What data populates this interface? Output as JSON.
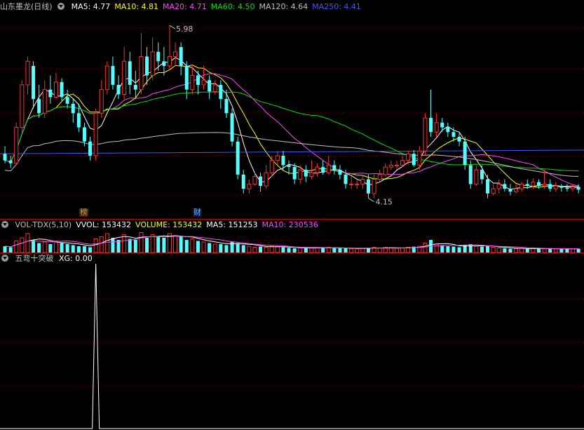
{
  "title": "山东墨龙(日线)",
  "ma_labels": [
    {
      "text": "MA5: 4.77",
      "color": "#ffffff"
    },
    {
      "text": "MA10: 4.81",
      "color": "#ffff00"
    },
    {
      "text": "MA20: 4.71",
      "color": "#ff44ff"
    },
    {
      "text": "MA60: 4.50",
      "color": "#00e000"
    },
    {
      "text": "MA120: 4.64",
      "color": "#c0c0c0"
    },
    {
      "text": "MA250: 4.41",
      "color": "#4455ff"
    }
  ],
  "vol_labels": [
    {
      "text": "VOL-TDX(5,10)",
      "color": "#c0c0c0"
    },
    {
      "text": "VVOL: 153432",
      "color": "#ffffff"
    },
    {
      "text": "VOLUME: 153432",
      "color": "#ffff00"
    },
    {
      "text": "MA5: 151253",
      "color": "#ffffff"
    },
    {
      "text": "MA10: 230536",
      "color": "#ff44ff"
    }
  ],
  "ind_title": "五弯十突破",
  "ind_value": "XG: 0.00",
  "high_label": "5.98",
  "low_label": "4.15",
  "badges": [
    "榜",
    "财"
  ],
  "colors": {
    "up": "#ff3030",
    "down": "#54ffff",
    "grid": "#8b0000",
    "frame": "#c00000"
  },
  "chart_data": {
    "type": "candlestick",
    "price": {
      "candles": [
        [
          4.62,
          4.55,
          4.7,
          4.52
        ],
        [
          4.55,
          4.52,
          4.6,
          4.47
        ],
        [
          4.52,
          4.9,
          4.95,
          4.5
        ],
        [
          4.9,
          5.35,
          5.4,
          4.85
        ],
        [
          5.35,
          5.6,
          5.65,
          5.25
        ],
        [
          5.55,
          5.2,
          5.6,
          5.1
        ],
        [
          5.2,
          5.05,
          5.35,
          5.0
        ],
        [
          5.05,
          5.3,
          5.4,
          5.0
        ],
        [
          5.3,
          5.22,
          5.45,
          5.15
        ],
        [
          5.22,
          5.38,
          5.48,
          5.2
        ],
        [
          5.38,
          5.22,
          5.42,
          5.18
        ],
        [
          5.22,
          5.15,
          5.3,
          5.1
        ],
        [
          5.15,
          5.05,
          5.2,
          4.95
        ],
        [
          5.05,
          4.9,
          5.15,
          4.85
        ],
        [
          4.9,
          4.75,
          4.95,
          4.7
        ],
        [
          4.75,
          4.6,
          4.8,
          4.55
        ],
        [
          4.6,
          5.05,
          5.1,
          4.55
        ],
        [
          5.05,
          5.3,
          5.4,
          5.0
        ],
        [
          5.3,
          5.55,
          5.6,
          5.25
        ],
        [
          5.55,
          5.35,
          5.65,
          5.3
        ],
        [
          5.35,
          5.25,
          5.45,
          5.2
        ],
        [
          5.25,
          5.6,
          5.75,
          5.2
        ],
        [
          5.6,
          5.35,
          5.7,
          5.25
        ],
        [
          5.35,
          5.3,
          5.5,
          5.2
        ],
        [
          5.3,
          5.65,
          5.9,
          5.25
        ],
        [
          5.65,
          5.45,
          5.75,
          5.35
        ],
        [
          5.45,
          5.7,
          5.85,
          5.4
        ],
        [
          5.7,
          5.6,
          5.8,
          5.5
        ],
        [
          5.6,
          5.55,
          5.75,
          5.45
        ],
        [
          5.55,
          5.65,
          5.98,
          5.5
        ],
        [
          5.65,
          5.7,
          5.8,
          5.55
        ],
        [
          5.75,
          5.55,
          5.8,
          5.45
        ],
        [
          5.55,
          5.3,
          5.6,
          5.2
        ],
        [
          5.3,
          5.45,
          5.55,
          5.25
        ],
        [
          5.45,
          5.35,
          5.5,
          5.25
        ],
        [
          5.35,
          5.4,
          5.55,
          5.3
        ],
        [
          5.4,
          5.28,
          5.45,
          5.2
        ],
        [
          5.28,
          5.35,
          5.4,
          5.25
        ],
        [
          5.35,
          5.2,
          5.4,
          5.1
        ],
        [
          5.2,
          5.05,
          5.3,
          5.0
        ],
        [
          5.05,
          4.75,
          5.1,
          4.7
        ],
        [
          4.75,
          4.4,
          4.8,
          4.35
        ],
        [
          4.4,
          4.25,
          4.45,
          4.2
        ],
        [
          4.25,
          4.3,
          4.35,
          4.2
        ],
        [
          4.3,
          4.38,
          4.42,
          4.28
        ],
        [
          4.38,
          4.28,
          4.42,
          4.22
        ],
        [
          4.28,
          4.42,
          4.5,
          4.25
        ],
        [
          4.42,
          4.55,
          4.6,
          4.38
        ],
        [
          4.55,
          4.6,
          4.65,
          4.5
        ],
        [
          4.6,
          4.5,
          4.65,
          4.45
        ],
        [
          4.5,
          4.48,
          4.55,
          4.4
        ],
        [
          4.48,
          4.35,
          4.52,
          4.3
        ],
        [
          4.35,
          4.45,
          4.5,
          4.3
        ],
        [
          4.45,
          4.38,
          4.5,
          4.32
        ],
        [
          4.38,
          4.42,
          4.55,
          4.35
        ],
        [
          4.42,
          4.48,
          4.52,
          4.38
        ],
        [
          4.48,
          4.42,
          4.55,
          4.4
        ],
        [
          4.42,
          4.5,
          4.6,
          4.4
        ],
        [
          4.5,
          4.45,
          4.55,
          4.4
        ],
        [
          4.45,
          4.4,
          4.5,
          4.35
        ],
        [
          4.4,
          4.3,
          4.45,
          4.25
        ],
        [
          4.3,
          4.3,
          4.38,
          4.25
        ],
        [
          4.3,
          4.3,
          4.35,
          4.25
        ],
        [
          4.3,
          4.35,
          4.4,
          4.25
        ],
        [
          4.35,
          4.2,
          4.4,
          4.15
        ],
        [
          4.2,
          4.35,
          4.4,
          4.15
        ],
        [
          4.35,
          4.4,
          4.45,
          4.32
        ],
        [
          4.4,
          4.48,
          4.52,
          4.38
        ],
        [
          4.48,
          4.5,
          4.55,
          4.45
        ],
        [
          4.5,
          4.5,
          4.55,
          4.45
        ],
        [
          4.5,
          4.55,
          4.6,
          4.48
        ],
        [
          4.55,
          4.62,
          4.65,
          4.5
        ],
        [
          4.62,
          4.5,
          4.66,
          4.48
        ],
        [
          4.5,
          4.65,
          4.7,
          4.45
        ],
        [
          4.65,
          5.0,
          5.05,
          4.6
        ],
        [
          5.0,
          4.85,
          5.3,
          4.8
        ],
        [
          4.85,
          4.95,
          5.05,
          4.8
        ],
        [
          4.95,
          4.9,
          5.0,
          4.85
        ],
        [
          4.9,
          4.85,
          4.95,
          4.8
        ],
        [
          4.85,
          4.8,
          4.9,
          4.75
        ],
        [
          4.8,
          4.75,
          4.85,
          4.7
        ],
        [
          4.75,
          4.5,
          4.8,
          4.45
        ],
        [
          4.5,
          4.3,
          4.55,
          4.25
        ],
        [
          4.3,
          4.45,
          4.5,
          4.28
        ],
        [
          4.45,
          4.35,
          4.5,
          4.3
        ],
        [
          4.35,
          4.2,
          4.4,
          4.15
        ],
        [
          4.2,
          4.25,
          4.3,
          4.18
        ],
        [
          4.25,
          4.3,
          4.35,
          4.2
        ],
        [
          4.3,
          4.25,
          4.35,
          4.22
        ],
        [
          4.25,
          4.22,
          4.3,
          4.18
        ],
        [
          4.22,
          4.25,
          4.3,
          4.2
        ],
        [
          4.25,
          4.3,
          4.32,
          4.22
        ],
        [
          4.3,
          4.28,
          4.35,
          4.25
        ],
        [
          4.28,
          4.32,
          4.36,
          4.25
        ],
        [
          4.32,
          4.28,
          4.35,
          4.25
        ],
        [
          4.28,
          4.3,
          4.45,
          4.25
        ],
        [
          4.3,
          4.25,
          4.35,
          4.22
        ],
        [
          4.25,
          4.28,
          4.32,
          4.22
        ],
        [
          4.28,
          4.26,
          4.3,
          4.22
        ],
        [
          4.26,
          4.25,
          4.3,
          4.22
        ],
        [
          4.25,
          4.27,
          4.3,
          4.22
        ],
        [
          4.27,
          4.24,
          4.3,
          4.2
        ]
      ],
      "ylim": [
        4.05,
        6.1
      ]
    },
    "volume": {
      "values": [
        30,
        25,
        55,
        70,
        90,
        60,
        45,
        50,
        40,
        55,
        45,
        40,
        35,
        30,
        30,
        25,
        65,
        75,
        90,
        70,
        60,
        85,
        65,
        60,
        95,
        70,
        85,
        75,
        70,
        90,
        80,
        75,
        60,
        65,
        55,
        50,
        45,
        40,
        40,
        35,
        50,
        45,
        35,
        30,
        25,
        28,
        25,
        30,
        28,
        25,
        22,
        20,
        22,
        20,
        22,
        24,
        22,
        25,
        22,
        20,
        20,
        18,
        18,
        20,
        22,
        25,
        22,
        24,
        22,
        20,
        22,
        25,
        28,
        30,
        45,
        60,
        40,
        35,
        30,
        28,
        25,
        35,
        40,
        30,
        28,
        30,
        25,
        22,
        20,
        18,
        18,
        20,
        18,
        20,
        18,
        18,
        18,
        17,
        18,
        17,
        18,
        18
      ],
      "ylim": [
        0,
        110
      ]
    },
    "indicator": {
      "name": "XG",
      "peak_index": 16,
      "ylim": [
        0,
        1
      ]
    }
  }
}
